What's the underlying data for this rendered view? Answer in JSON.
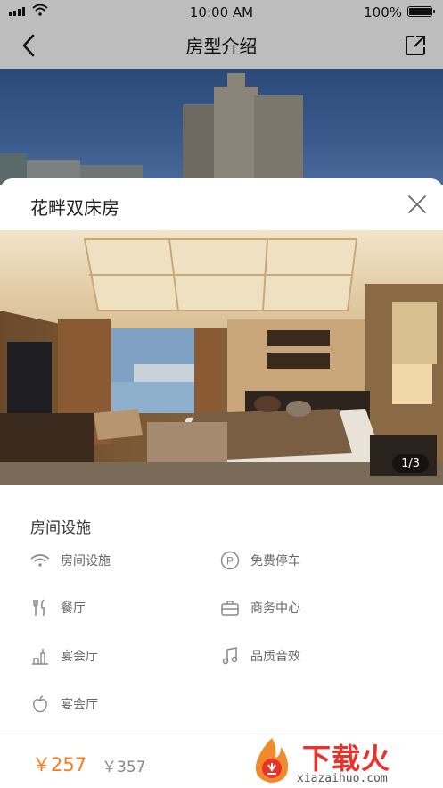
{
  "status": {
    "time": "10:00 AM",
    "battery": "100%"
  },
  "header": {
    "title": "房型介绍"
  },
  "sheet": {
    "title": "花畔双床房",
    "photo_counter": "1/3",
    "section_title": "房间设施",
    "amenities": [
      {
        "icon": "wifi-icon",
        "label": "房间设施"
      },
      {
        "icon": "parking-icon",
        "label": "免费停车"
      },
      {
        "icon": "fork-knife-icon",
        "label": "餐厅"
      },
      {
        "icon": "briefcase-icon",
        "label": "商务中心"
      },
      {
        "icon": "banquet-icon",
        "label": "宴会厅"
      },
      {
        "icon": "music-note-icon",
        "label": "品质音效"
      },
      {
        "icon": "apple-icon",
        "label": "宴会厅"
      }
    ]
  },
  "footer": {
    "price": "￥257",
    "old_price": "￥357"
  },
  "watermark": {
    "text": "下载火",
    "url": "xiazaihuo.com"
  },
  "colors": {
    "accent": "#f47d20",
    "watermark": "#e8322a"
  }
}
